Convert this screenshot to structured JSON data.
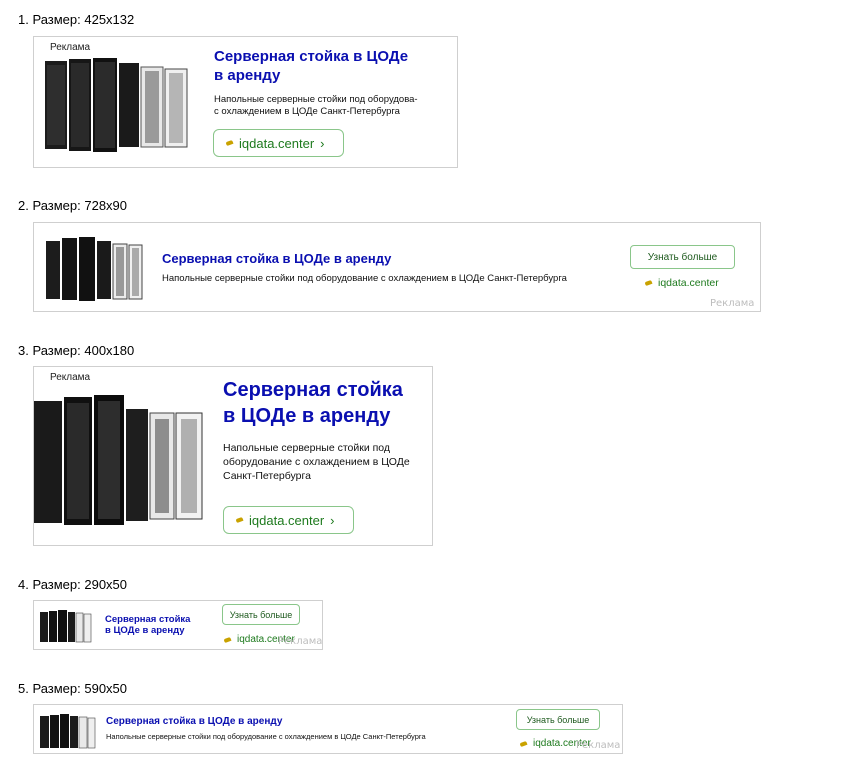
{
  "items": [
    {
      "caption": "1. Размер: 425x132"
    },
    {
      "caption": "2. Размер: 728x90"
    },
    {
      "caption": "3. Размер: 400x180"
    },
    {
      "caption": "4. Размер: 290x50"
    },
    {
      "caption": "5. Размер: 590x50"
    }
  ],
  "ad": {
    "label": "Реклама",
    "title": "Серверная стойка в ЦОДе в аренду",
    "title_line1": "Серверная стойка в ЦОДе",
    "title_line2": "в аренду",
    "title_big_line1": "Серверная стойка",
    "title_big_line2": "в ЦОДе в аренду",
    "title_small_line1": "Серверная стойка",
    "title_small_line2": "в ЦОДе в аренду",
    "desc_full": "Напольные серверные стойки под оборудование с охлаждением в ЦОДе Санкт-Петербурга",
    "desc1_line1": "Напольные серверные стойки под оборудова-",
    "desc1_line2": "с охлаждением в ЦОДе Санкт-Петербурга",
    "desc3_line1": "Напольные серверные стойки под",
    "desc3_line2": "оборудование с охлаждением в ЦОДе",
    "desc3_line3": "Санкт-Петербурга",
    "domain": "iqdata.center",
    "cta": "Узнать больше"
  },
  "icons": {
    "favicon": "leaf-favicon-icon",
    "chevron": "chevron-right-icon",
    "image": "server-racks-image"
  },
  "colors": {
    "title": "#0a0fb0",
    "domain": "#1e7a1e",
    "border": "#cfcfcf",
    "button_border": "#8ac68a"
  }
}
